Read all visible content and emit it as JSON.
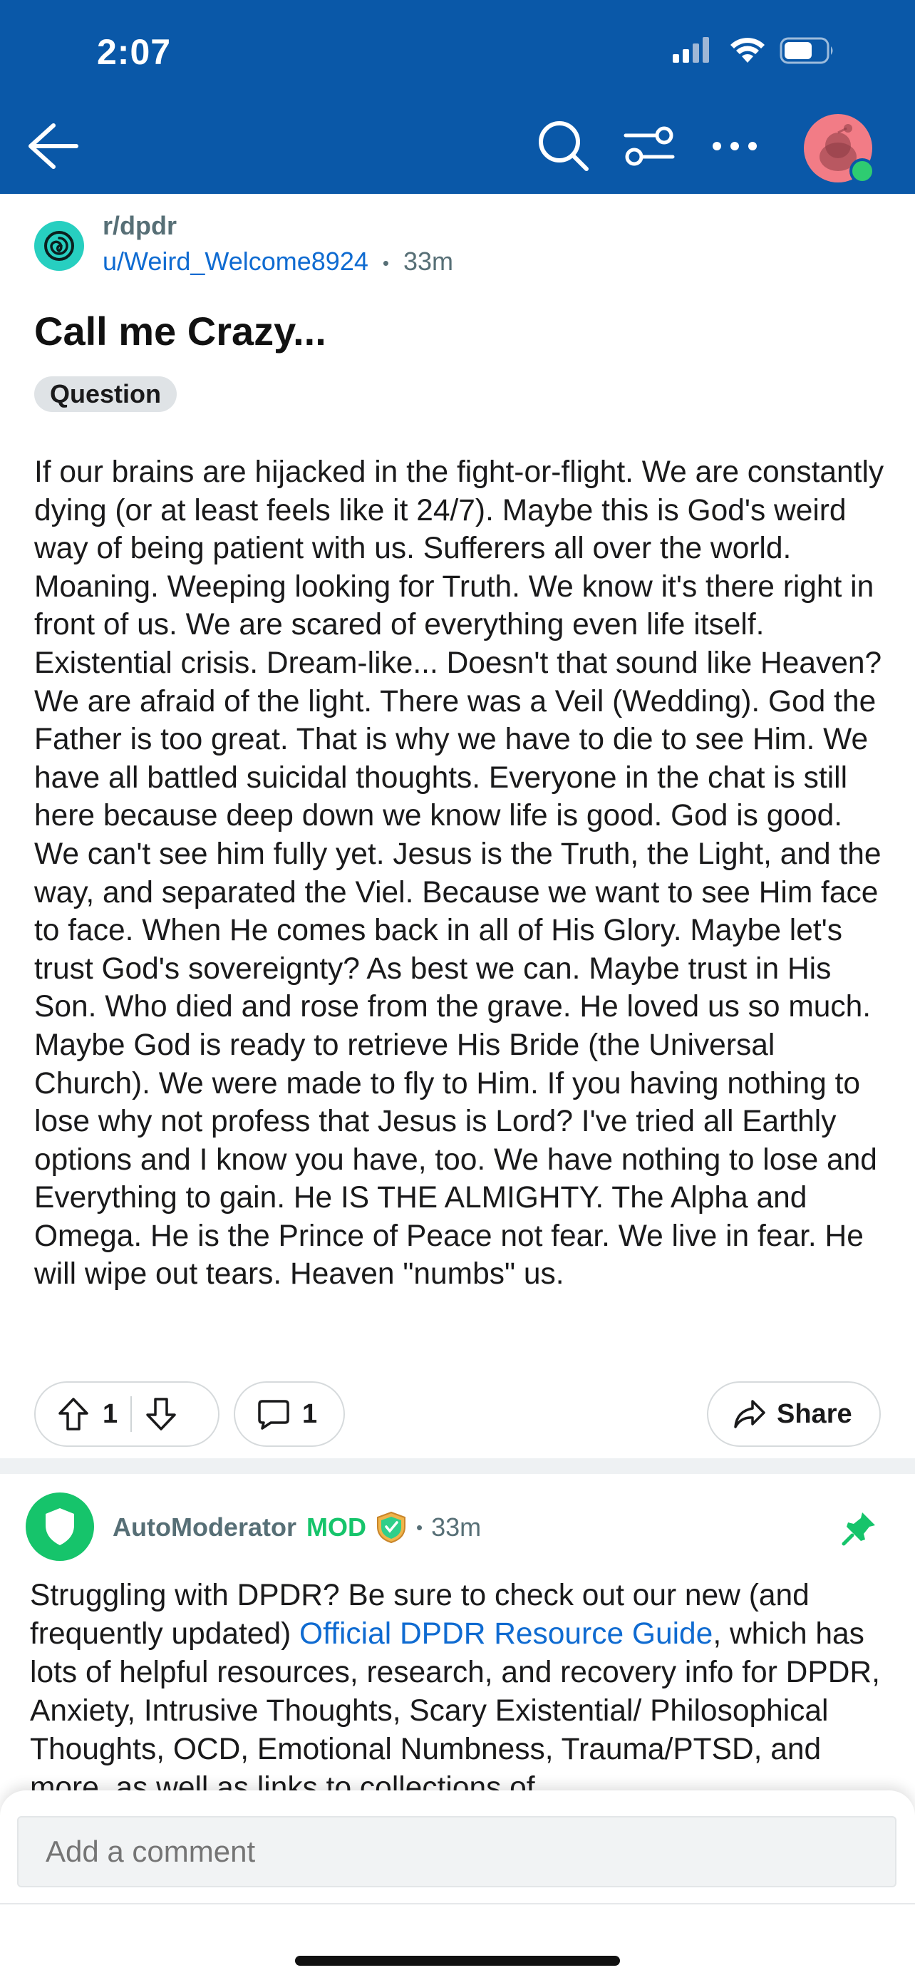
{
  "status_bar": {
    "time": "2:07"
  },
  "post": {
    "subreddit": "r/dpdr",
    "author": "u/Weird_Welcome8924",
    "separator": "•",
    "age": "33m",
    "title": "Call me Crazy...",
    "flair": "Question",
    "body": "If our brains are hijacked in the fight-or-flight. We are constantly dying (or at least feels like it 24/7). Maybe this is God's weird way of being patient with us. Sufferers all over the world. Moaning. Weeping looking for Truth. We know it's there right in front of us. We are scared of everything even life itself. Existential crisis. Dream-like... Doesn't that sound like Heaven? We are afraid of the light. There was a Veil (Wedding). God the Father is too great. That is why we have to die to see Him. We have all battled suicidal thoughts. Everyone in the chat is still here because deep down we know life is good. God is good. We can't see him fully yet. Jesus is the Truth, the Light, and the way, and separated the Viel. Because we want to see Him face to face. When He comes back in all of His Glory. Maybe let's trust God's sovereignty? As best we can. Maybe trust in His Son. Who died and rose from the grave. He loved us so much. Maybe God is ready to retrieve His Bride (the Universal Church). We were made to fly to Him. If you having nothing to lose why not profess that Jesus is Lord? I've tried all Earthly options and I know you have, too. We have nothing to lose and Everything to gain. He IS THE ALMIGHTY. The Alpha and Omega. He is the Prince of Peace not fear. We live in fear. He will wipe out tears. Heaven \"numbs\" us.",
    "upvotes": "1",
    "comments": "1",
    "share_label": "Share"
  },
  "comment": {
    "author": "AutoModerator",
    "mod_tag": "MOD",
    "separator": "•",
    "age": "33m",
    "text_before_link": "Struggling with DPDR? Be sure to check out our new (and frequently updated) ",
    "link_text": "Official DPDR Resource Guide",
    "text_after_link": ", which has lots of helpful resources, research, and recovery info for DPDR, Anxiety, Intrusive Thoughts, Scary Existential/ Philosophical Thoughts, OCD, Emotional Numbness, Trauma/PTSD, and more, as well as links to collections of"
  },
  "composer": {
    "placeholder": "Add a comment"
  },
  "colors": {
    "header_bg": "#0a58a8",
    "link": "#0f6bd1",
    "mod_green": "#16c46b",
    "subreddit_icon": "#27cfc0",
    "avatar_bg": "#f27c86"
  }
}
